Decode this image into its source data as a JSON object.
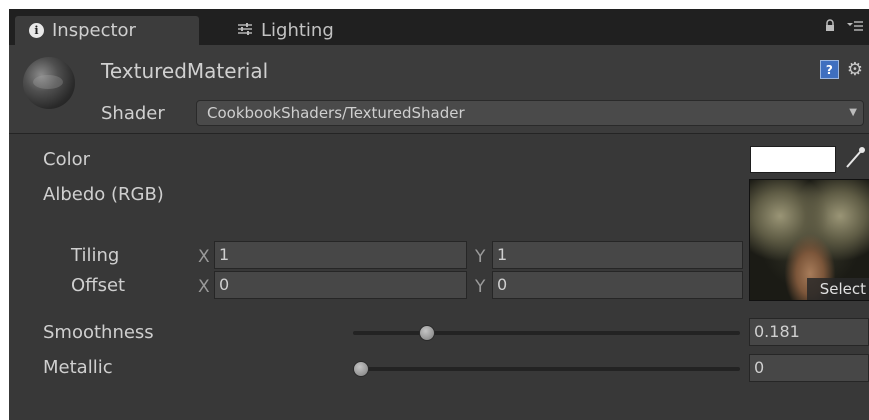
{
  "tabs": [
    {
      "label": "Inspector",
      "icon": "info-icon",
      "active": true
    },
    {
      "label": "Lighting",
      "icon": "lighting-sliders-icon",
      "active": false
    }
  ],
  "tab_icons": {
    "lock": "lock-icon",
    "menu": "tab-menu-icon"
  },
  "header": {
    "material_name": "TexturedMaterial",
    "shader_label": "Shader",
    "shader_value": "CookbookShaders/TexturedShader",
    "help_glyph": "?"
  },
  "properties": {
    "color_label": "Color",
    "color_value": "#ffffff",
    "albedo_label": "Albedo (RGB)",
    "texture_select": "Select",
    "tiling_label": "Tiling",
    "offset_label": "Offset",
    "axis_x": "X",
    "axis_y": "Y",
    "tiling_x": "1",
    "tiling_y": "1",
    "offset_x": "0",
    "offset_y": "0",
    "smoothness_label": "Smoothness",
    "smoothness_value": "0.181",
    "metallic_label": "Metallic",
    "metallic_value": "0"
  },
  "colors": {
    "panel": "#383838",
    "tabbar": "#202020",
    "text": "#cfcfcf",
    "help_icon": "#3f6fbf"
  }
}
